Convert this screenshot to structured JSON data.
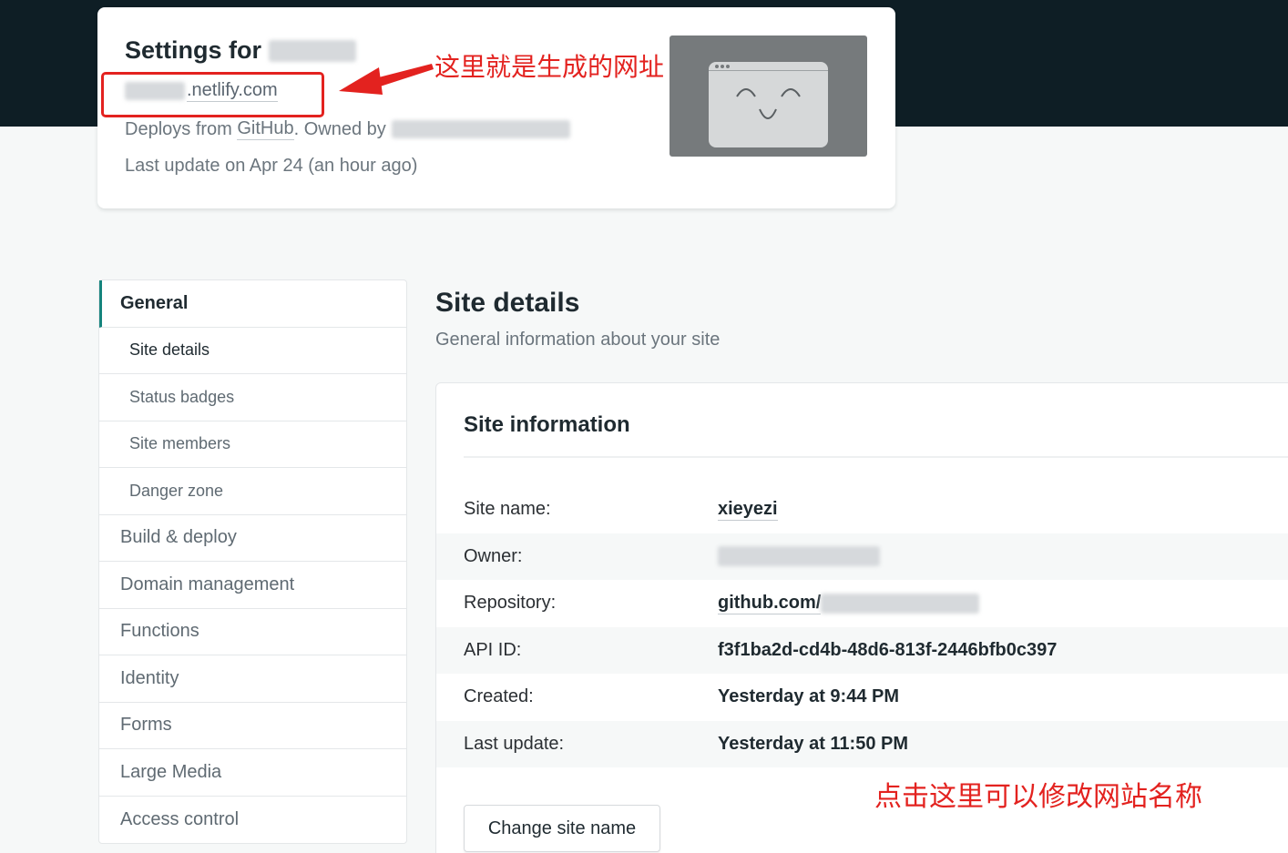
{
  "header": {
    "title": "Settings for",
    "url_suffix": ".netlify.com",
    "deploy_prefix": "Deploys from",
    "deploy_source": "GitHub",
    "deploy_owned": ". Owned by",
    "last_update": "Last update on Apr 24 (an hour ago)"
  },
  "annotations": {
    "url_note": "这里就是生成的网址",
    "rename_note": "点击这里可以修改网站名称",
    "color": "#e3221f"
  },
  "sidebar": {
    "items": [
      {
        "label": "General",
        "level": "main",
        "active": true
      },
      {
        "label": "Site details",
        "level": "sub",
        "active": true
      },
      {
        "label": "Status badges",
        "level": "sub"
      },
      {
        "label": "Site members",
        "level": "sub"
      },
      {
        "label": "Danger zone",
        "level": "sub"
      },
      {
        "label": "Build & deploy",
        "level": "main"
      },
      {
        "label": "Domain management",
        "level": "main"
      },
      {
        "label": "Functions",
        "level": "main"
      },
      {
        "label": "Identity",
        "level": "main"
      },
      {
        "label": "Forms",
        "level": "main"
      },
      {
        "label": "Large Media",
        "level": "main"
      },
      {
        "label": "Access control",
        "level": "main"
      }
    ]
  },
  "main": {
    "title": "Site details",
    "subtitle": "General information about your site",
    "card_title": "Site information",
    "rows": [
      {
        "label": "Site name:",
        "value": "xieyezi"
      },
      {
        "label": "Owner:",
        "value": ""
      },
      {
        "label": "Repository:",
        "value": "github.com/"
      },
      {
        "label": "API ID:",
        "value": "f3f1ba2d-cd4b-48d6-813f-2446bfb0c397"
      },
      {
        "label": "Created:",
        "value": "Yesterday at 9:44 PM"
      },
      {
        "label": "Last update:",
        "value": "Yesterday at 11:50 PM"
      }
    ],
    "change_button": "Change site name"
  },
  "colors": {
    "nav_dark": "#0e1e25",
    "accent": "#15847d",
    "annotation_red": "#e3221f"
  }
}
